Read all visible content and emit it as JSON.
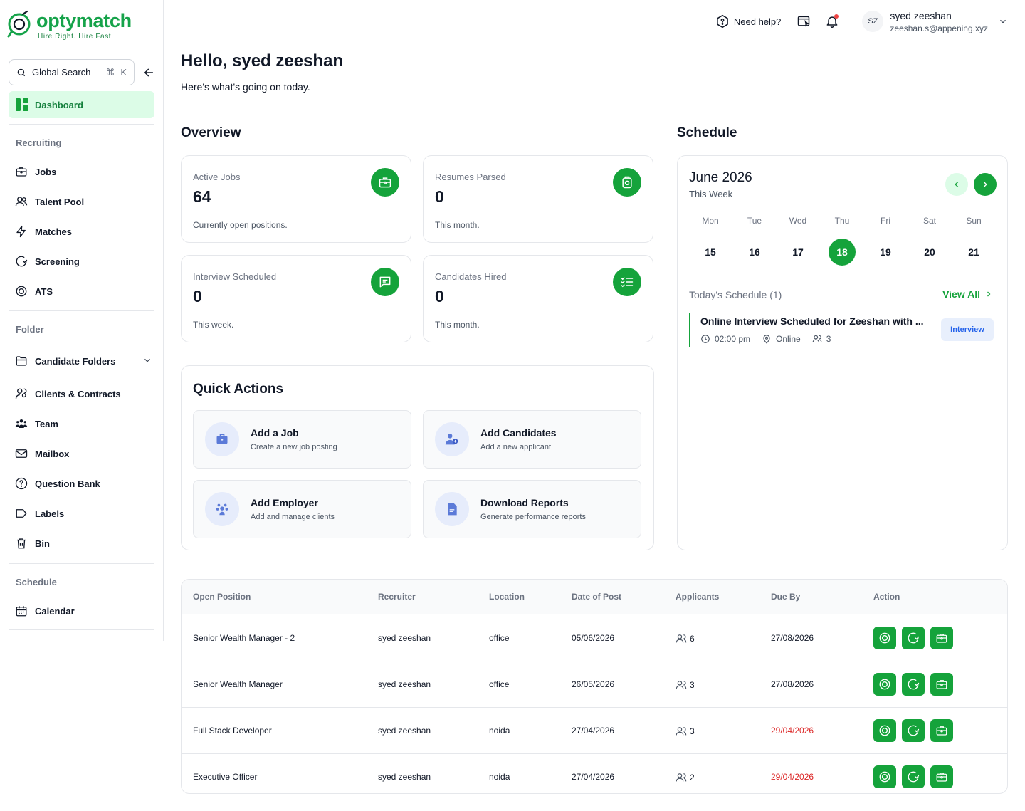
{
  "brand": {
    "name": "optymatch",
    "tagline": "Hire Right. Hire Fast",
    "accent": "#15a33b"
  },
  "search": {
    "label": "Global Search",
    "shortcut_cmd": "⌘",
    "shortcut_key": "K"
  },
  "sidebar": {
    "active": {
      "label": "Dashboard",
      "icon": "dashboard-icon"
    },
    "sections": {
      "recruiting": "Recruiting",
      "folder": "Folder",
      "schedule": "Schedule"
    },
    "recruiting_items": [
      {
        "label": "Jobs",
        "icon": "briefcase-icon"
      },
      {
        "label": "Talent Pool",
        "icon": "people-icon"
      },
      {
        "label": "Matches",
        "icon": "lightning-icon"
      },
      {
        "label": "Screening",
        "icon": "screening-icon"
      },
      {
        "label": "ATS",
        "icon": "ats-icon"
      }
    ],
    "folder_items": [
      {
        "label": "Candidate Folders",
        "icon": "folder-icon"
      },
      {
        "label": "Clients & Contracts",
        "icon": "clients-icon"
      },
      {
        "label": "Team",
        "icon": "team-icon"
      },
      {
        "label": "Mailbox",
        "icon": "mail-icon"
      },
      {
        "label": "Question Bank",
        "icon": "question-icon"
      },
      {
        "label": "Labels",
        "icon": "label-icon"
      },
      {
        "label": "Bin",
        "icon": "trash-icon"
      }
    ],
    "schedule_items": [
      {
        "label": "Calendar",
        "icon": "calendar-icon"
      }
    ]
  },
  "header": {
    "help_label": "Need help?",
    "user_initials": "SZ",
    "user_name": "syed zeeshan",
    "user_email": "zeeshan.s@appening.xyz"
  },
  "greeting": {
    "title": "Hello, syed zeeshan",
    "subtitle": "Here's what's going on today."
  },
  "overview": {
    "title": "Overview",
    "cards": [
      {
        "title": "Active Jobs",
        "value": "64",
        "desc": "Currently open positions.",
        "icon": "briefcase-icon"
      },
      {
        "title": "Resumes Parsed",
        "value": "0",
        "desc": "This month.",
        "icon": "parse-icon"
      },
      {
        "title": "Interview Scheduled",
        "value": "0",
        "desc": "This week.",
        "icon": "interview-icon"
      },
      {
        "title": "Candidates Hired",
        "value": "0",
        "desc": "This month.",
        "icon": "checklist-icon"
      }
    ]
  },
  "quick_actions": {
    "title": "Quick Actions",
    "items": [
      {
        "title": "Add a Job",
        "sub": "Create a new job posting",
        "icon": "briefcase-icon"
      },
      {
        "title": "Add Candidates",
        "sub": "Add a new applicant",
        "icon": "add-people-icon"
      },
      {
        "title": "Add Employer",
        "sub": "Add and manage clients",
        "icon": "employer-icon"
      },
      {
        "title": "Download Reports",
        "sub": "Generate performance reports",
        "icon": "report-icon"
      }
    ]
  },
  "schedule": {
    "title": "Schedule",
    "month": "June 2026",
    "week_label": "This Week",
    "days": [
      {
        "name": "Mon",
        "num": "15"
      },
      {
        "name": "Tue",
        "num": "16"
      },
      {
        "name": "Wed",
        "num": "17"
      },
      {
        "name": "Thu",
        "num": "18",
        "selected": true
      },
      {
        "name": "Fri",
        "num": "19"
      },
      {
        "name": "Sat",
        "num": "20"
      },
      {
        "name": "Sun",
        "num": "21"
      }
    ],
    "today_label": "Today's Schedule (1)",
    "view_all": "View All",
    "event": {
      "title": "Online Interview Scheduled for Zeeshan with ...",
      "time": "02:00 pm",
      "location": "Online",
      "attendees": "3",
      "badge": "Interview"
    }
  },
  "table": {
    "headers": [
      "Open Position",
      "Recruiter",
      "Location",
      "Date of Post",
      "Applicants",
      "Due By",
      "Action"
    ],
    "rows": [
      {
        "position": "Senior Wealth Manager - 2",
        "recruiter": "syed zeeshan",
        "location": "office",
        "posted": "05/06/2026",
        "applicants": "6",
        "due": "27/08/2026",
        "overdue": false
      },
      {
        "position": "Senior Wealth Manager",
        "recruiter": "syed zeeshan",
        "location": "office",
        "posted": "26/05/2026",
        "applicants": "3",
        "due": "27/08/2026",
        "overdue": false
      },
      {
        "position": "Full Stack Developer",
        "recruiter": "syed zeeshan",
        "location": "noida",
        "posted": "27/04/2026",
        "applicants": "3",
        "due": "29/04/2026",
        "overdue": true
      },
      {
        "position": "Executive Officer",
        "recruiter": "syed zeeshan",
        "location": "noida",
        "posted": "27/04/2026",
        "applicants": "2",
        "due": "29/04/2026",
        "overdue": true
      }
    ]
  }
}
